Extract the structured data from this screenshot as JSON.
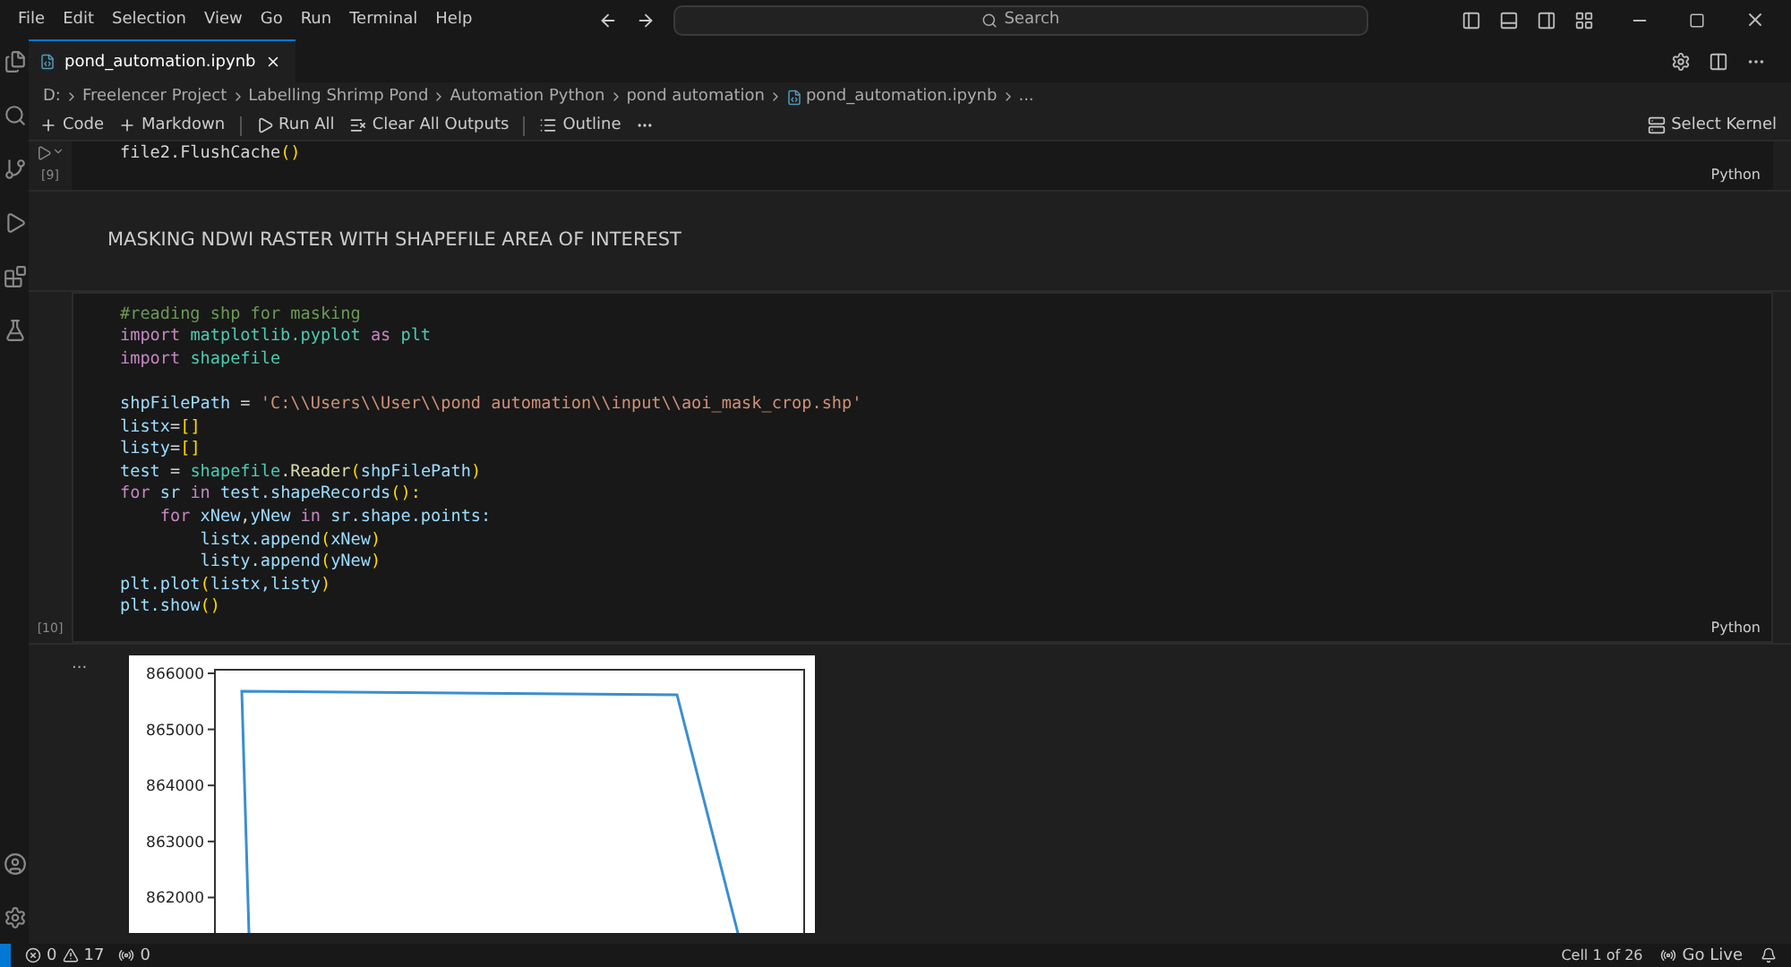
{
  "menu": [
    "File",
    "Edit",
    "Selection",
    "View",
    "Go",
    "Run",
    "Terminal",
    "Help"
  ],
  "search": {
    "placeholder": "Search"
  },
  "tabs": [
    {
      "label": "pond_automation.ipynb",
      "selected": true
    }
  ],
  "breadcrumb": [
    "D:",
    "Freelencer Project",
    "Labelling Shrimp Pond",
    "Automation Python",
    "pond automation",
    "pond_automation.ipynb",
    "..."
  ],
  "toolbar": [
    "Code",
    "Markdown",
    "Run All",
    "Clear All Outputs",
    "Outline"
  ],
  "kernel": "Select Kernel",
  "cells": [
    {
      "kind": "code",
      "count": "[9]",
      "language": "Python",
      "lines": [
        {
          "tokens": [
            {
              "text": "file2.FlushCache",
              "kind": "plain"
            },
            {
              "text": "()",
              "kind": "paren"
            }
          ]
        }
      ]
    },
    {
      "kind": "markdown",
      "text": "MASKING NDWI RASTER WITH SHAPEFILE AREA OF INTEREST"
    },
    {
      "kind": "code",
      "count": "[10]",
      "language": "Python",
      "lines": [
        {
          "tokens": [
            {
              "text": "#reading shp for masking",
              "kind": "comment"
            }
          ]
        },
        {
          "tokens": [
            {
              "text": "import ",
              "kind": "keyword"
            },
            {
              "text": "matplotlib.pyplot",
              "kind": "module"
            },
            {
              "text": " as ",
              "kind": "keyword"
            },
            {
              "text": "plt",
              "kind": "module"
            }
          ]
        },
        {
          "tokens": [
            {
              "text": "import ",
              "kind": "keyword"
            },
            {
              "text": "shapefile",
              "kind": "module"
            }
          ]
        },
        {
          "space_before": true,
          "tokens": [
            {
              "text": "shpFilePath",
              "kind": "var"
            },
            {
              "text": " = ",
              "kind": "plain"
            },
            {
              "text": "'C:\\\\Users\\\\User\\\\pond automation\\\\input\\\\aoi_mask_crop.shp'",
              "kind": "string"
            }
          ]
        },
        {
          "tokens": [
            {
              "text": "listx",
              "kind": "var"
            },
            {
              "text": "=",
              "kind": "plain"
            },
            {
              "text": "[]",
              "kind": "paren"
            }
          ]
        },
        {
          "tokens": [
            {
              "text": "listy",
              "kind": "var"
            },
            {
              "text": "=",
              "kind": "plain"
            },
            {
              "text": "[]",
              "kind": "paren"
            }
          ]
        },
        {
          "tokens": [
            {
              "text": "test",
              "kind": "var"
            },
            {
              "text": " = ",
              "kind": "plain"
            },
            {
              "text": "shapefile",
              "kind": "module"
            },
            {
              "text": ".Reader",
              "kind": "func"
            },
            {
              "text": "(",
              "kind": "paren"
            },
            {
              "text": "shpFilePath",
              "kind": "var"
            },
            {
              "text": ")",
              "kind": "paren"
            }
          ]
        },
        {
          "tokens": [
            {
              "text": "for ",
              "kind": "keyword"
            },
            {
              "text": "sr",
              "kind": "var"
            },
            {
              "text": " in ",
              "kind": "keyword"
            },
            {
              "text": "test.shapeRecords",
              "kind": "var"
            },
            {
              "text": "():",
              "kind": "paren"
            }
          ]
        },
        {
          "tokens": [
            {
              "text": "    for ",
              "kind": "keyword"
            },
            {
              "text": "xNew",
              "kind": "var"
            },
            {
              "text": ",",
              "kind": "plain"
            },
            {
              "text": "yNew",
              "kind": "var"
            },
            {
              "text": " in ",
              "kind": "keyword"
            },
            {
              "text": "sr.shape.points:",
              "kind": "var"
            }
          ]
        },
        {
          "tokens": [
            {
              "text": "        listx.append",
              "kind": "var"
            },
            {
              "text": "(",
              "kind": "paren"
            },
            {
              "text": "xNew",
              "kind": "var"
            },
            {
              "text": ")",
              "kind": "paren"
            }
          ]
        },
        {
          "tokens": [
            {
              "text": "        listy.append",
              "kind": "var"
            },
            {
              "text": "(",
              "kind": "paren"
            },
            {
              "text": "yNew",
              "kind": "var"
            },
            {
              "text": ")",
              "kind": "paren"
            }
          ]
        },
        {
          "tokens": [
            {
              "text": "plt.plot",
              "kind": "var"
            },
            {
              "text": "(",
              "kind": "paren"
            },
            {
              "text": "listx,listy",
              "kind": "var"
            },
            {
              "text": ")",
              "kind": "paren"
            }
          ]
        },
        {
          "tokens": [
            {
              "text": "plt.show",
              "kind": "var"
            },
            {
              "text": "()",
              "kind": "paren"
            }
          ]
        }
      ]
    },
    {
      "kind": "output",
      "more": "...",
      "plot": {
        "y_labels": [
          "866000",
          "865000",
          "864000",
          "863000",
          "862000"
        ]
      }
    }
  ],
  "status": {
    "errors": "0",
    "warnings": "17",
    "ports": "0",
    "cell": "Cell 1 of 26",
    "live": "Go Live"
  }
}
